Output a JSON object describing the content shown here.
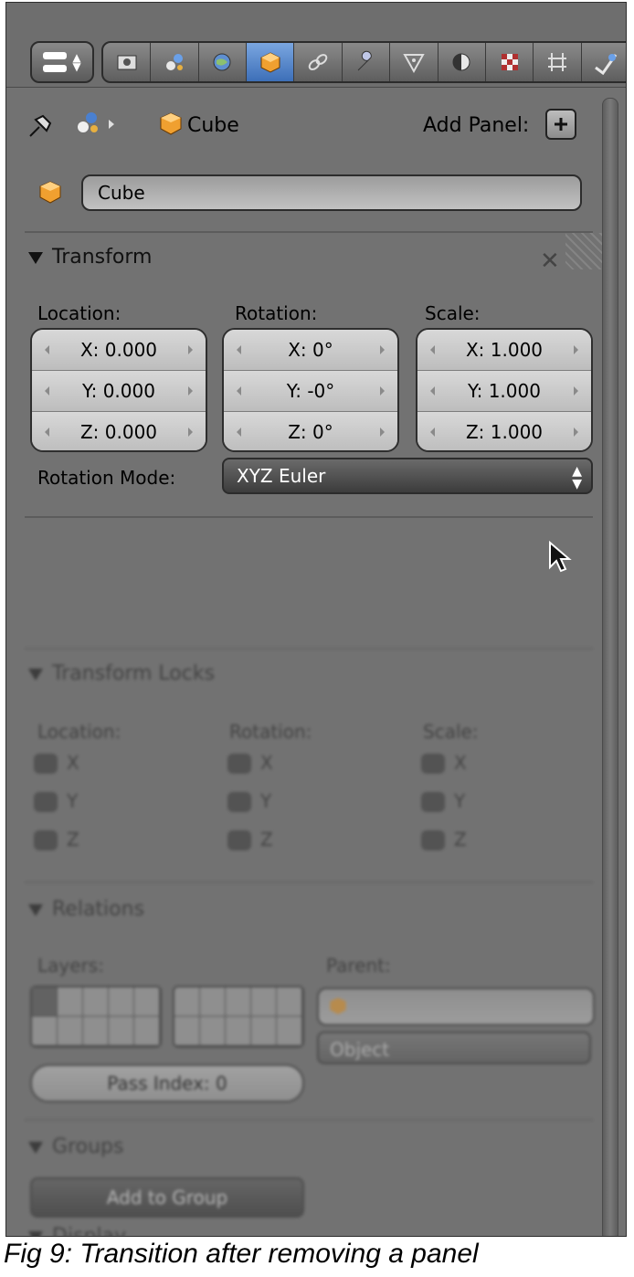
{
  "toolbar": {
    "menu_icon": "editor-type-icon",
    "tabs": [
      {
        "name": "render-icon",
        "active": false
      },
      {
        "name": "scene-icon",
        "active": false
      },
      {
        "name": "world-icon",
        "active": false
      },
      {
        "name": "object-icon",
        "active": true
      },
      {
        "name": "constraints-icon",
        "active": false
      },
      {
        "name": "modifier-icon",
        "active": false
      },
      {
        "name": "data-icon",
        "active": false
      },
      {
        "name": "material-icon",
        "active": false
      },
      {
        "name": "texture-icon",
        "active": false
      },
      {
        "name": "particles-icon",
        "active": false
      },
      {
        "name": "physics-icon",
        "active": false
      }
    ]
  },
  "header": {
    "breadcrumb_object": "Cube",
    "add_panel_label": "Add Panel:"
  },
  "object_name": "Cube",
  "transform": {
    "title": "Transform",
    "location_label": "Location:",
    "rotation_label": "Rotation:",
    "scale_label": "Scale:",
    "location": [
      "X: 0.000",
      "Y: 0.000",
      "Z: 0.000"
    ],
    "rotation": [
      "X: 0°",
      "Y: -0°",
      "Z: 0°"
    ],
    "scale": [
      "X: 1.000",
      "Y: 1.000",
      "Z: 1.000"
    ],
    "rotation_mode_label": "Rotation Mode:",
    "rotation_mode_value": "XYZ Euler"
  },
  "transform_locks": {
    "title": "Transform Locks",
    "location_label": "Location:",
    "rotation_label": "Rotation:",
    "scale_label": "Scale:",
    "axes": [
      "X",
      "Y",
      "Z"
    ]
  },
  "relations": {
    "title": "Relations",
    "layers_label": "Layers:",
    "parent_label": "Parent:",
    "parent_type": "Object",
    "pass_index": "Pass Index: 0"
  },
  "groups": {
    "title": "Groups",
    "add_to_group": "Add to Group"
  },
  "display": {
    "title": "Display"
  },
  "caption": "Fig 9: Transition after removing a panel",
  "colors": {
    "panel_bg": "#727272",
    "active_tab": "#3d6fb8",
    "cube_orange": "#f0a030"
  }
}
